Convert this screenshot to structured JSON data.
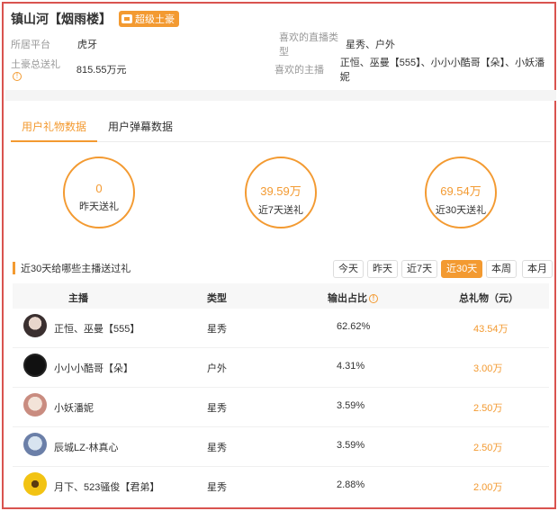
{
  "header": {
    "title": "镇山河【烟雨楼】",
    "badge": "超级土豪"
  },
  "info": {
    "platform_label": "所居平台",
    "platform_value": "虎牙",
    "fav_types_label": "喜欢的直播类型",
    "fav_types_value": "星秀、户外",
    "total_gift_label": "土豪总送礼",
    "total_gift_value": "815.55万元",
    "fav_hosts_label": "喜欢的主播",
    "fav_hosts_value": "正恒、巫曼【555】、小小小酷哥【朵】、小妖潘妮"
  },
  "tabs": [
    "用户礼物数据",
    "用户弹幕数据"
  ],
  "stats": [
    {
      "value": "0",
      "label": "昨天送礼"
    },
    {
      "value": "39.59万",
      "label": "近7天送礼"
    },
    {
      "value": "69.54万",
      "label": "近30天送礼"
    }
  ],
  "section_title": "近30天给哪些主播送过礼",
  "ranges": [
    "今天",
    "昨天",
    "近7天",
    "近30天",
    "本周",
    "本月"
  ],
  "active_range": "近30天",
  "table": {
    "columns": [
      "主播",
      "类型",
      "输出占比",
      "总礼物（元）"
    ],
    "rows": [
      {
        "name": "正恒、巫曼【555】",
        "type": "星秀",
        "ratio": "62.62%",
        "gift": "43.54万"
      },
      {
        "name": "小小小酷哥【朵】",
        "type": "户外",
        "ratio": "4.31%",
        "gift": "3.00万"
      },
      {
        "name": "小妖潘妮",
        "type": "星秀",
        "ratio": "3.59%",
        "gift": "2.50万"
      },
      {
        "name": "辰城LZ-林真心",
        "type": "星秀",
        "ratio": "3.59%",
        "gift": "2.50万"
      },
      {
        "name": "月下、523骚俊【君弟】",
        "type": "星秀",
        "ratio": "2.88%",
        "gift": "2.00万"
      }
    ]
  },
  "colors": {
    "accent": "#f39a31",
    "frame": "#d9534f"
  }
}
